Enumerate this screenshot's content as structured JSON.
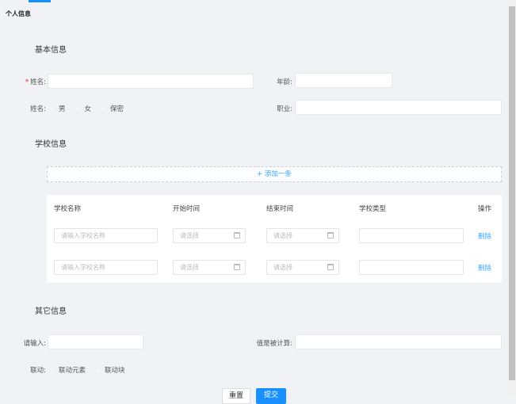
{
  "page_title": "个人信息",
  "basic": {
    "title": "基本信息",
    "name_label": "姓名:",
    "age_label": "年龄:",
    "gender_label": "姓名:",
    "gender_options": [
      "男",
      "女",
      "保密"
    ],
    "job_label": "职业:"
  },
  "school": {
    "title": "学校信息",
    "add_label": "+ 添加一条",
    "columns": [
      "学校名称",
      "开始时间",
      "结束时间",
      "学校类型",
      "操作"
    ],
    "rows": [
      {
        "name_placeholder": "请输入学校名称",
        "start_placeholder": "请选择",
        "end_placeholder": "请选择",
        "action": "删除"
      },
      {
        "name_placeholder": "请输入学校名称",
        "start_placeholder": "请选择",
        "end_placeholder": "请选择",
        "action": "删除"
      }
    ]
  },
  "other": {
    "title": "其它信息",
    "input_label": "请输入:",
    "computed_label": "值是被计算:",
    "link_label": "联动:",
    "link_options": [
      "联动元素",
      "联动块"
    ]
  },
  "actions": {
    "reset": "重置",
    "submit": "提交"
  },
  "colors": {
    "primary": "#1890ff",
    "required": "#f5222d"
  }
}
